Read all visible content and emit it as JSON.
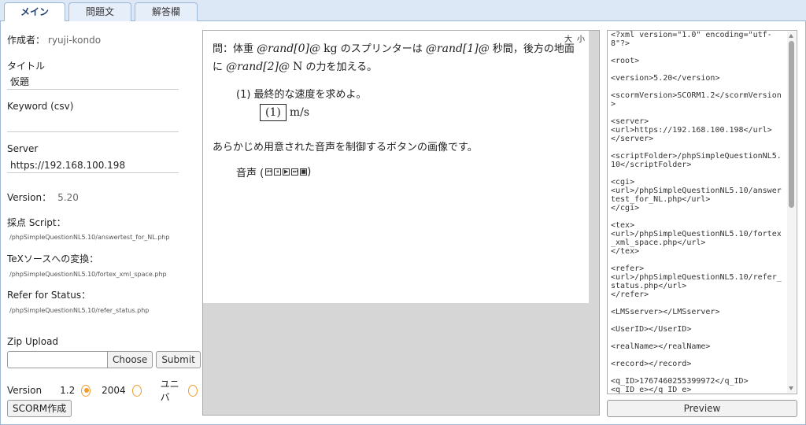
{
  "tabs": [
    {
      "label": "メイン",
      "active": true
    },
    {
      "label": "問題文",
      "active": false
    },
    {
      "label": "解答欄",
      "active": false
    }
  ],
  "left": {
    "author_label": "作成者：",
    "author_value": "ryuji-kondo",
    "title_label": "タイトル",
    "title_value": "仮題",
    "keyword_label": "Keyword (csv)",
    "keyword_value": "",
    "server_label": "Server",
    "server_value": "https://192.168.100.198",
    "version_label": "Version：",
    "version_value": "5.20",
    "script_label": "採点 Script：",
    "script_value": "/phpSimpleQuestionNL5.10/answertest_for_NL.php",
    "tex_label": "TeXソースへの変換：",
    "tex_value": "/phpSimpleQuestionNL5.10/fortex_xml_space.php",
    "refer_label": "Refer for Status：",
    "refer_value": "/phpSimpleQuestionNL5.10/refer_status.php",
    "zip_label": "Zip Upload",
    "choose_label": "Choose",
    "submit_label": "Submit",
    "radio_label": "Version",
    "radio_options": [
      {
        "label": "1.2",
        "checked": true
      },
      {
        "label": "2004",
        "checked": false
      },
      {
        "label": "ユニバ",
        "checked": false
      }
    ],
    "scorm_button": "SCORM作成"
  },
  "preview": {
    "size_large": "大",
    "size_small": "小",
    "q_prefix": "問：体重",
    "q_rand0": "@rand[0]@",
    "q_unit_kg": "kg",
    "q_mid1": "のスプリンターは",
    "q_rand1": "@rand[1]@",
    "q_mid2": "秒間，後方の地面に",
    "q_rand2": "@rand[2]@",
    "q_unit_n": "N",
    "q_end": "の力を加える。",
    "sub_question": "(1) 最終的な速度を求めよ。",
    "answer_box": "(1)",
    "answer_unit": "m/s",
    "description": "あらかじめ用意された音声を制御するボタンの画像です。",
    "audio_label": "音声 (",
    "audio_close": ")",
    "audio_controls": [
      "⏮",
      "⏸",
      "▶",
      "⏭",
      "■"
    ]
  },
  "xml": "<?xml version=\"1.0\" encoding=\"utf-8\"?>\n\n<root>\n\n<version>5.20</version>\n\n<scormVersion>SCORM1.2</scormVersion>\n\n<server>\n<url>https://192.168.100.198</url>\n</server>\n\n<scriptFolder>/phpSimpleQuestionNL5.10</scriptFolder>\n\n<cgi>\n<url>/phpSimpleQuestionNL5.10/answertest_for_NL.php</url>\n</cgi>\n\n<tex>\n<url>/phpSimpleQuestionNL5.10/fortex_xml_space.php</url>\n</tex>\n\n<refer>\n<url>/phpSimpleQuestionNL5.10/refer_status.php</url>\n</refer>\n\n<LMSserver></LMSserver>\n\n<UserID></UserID>\n\n<realName></realName>\n\n<record></record>\n\n<q_ID>1767460255399972</q_ID>\n<q_ID_e></q_ID_e>\n\n<author_name>ryuji-kondo</author_name>",
  "preview_button": "Preview"
}
